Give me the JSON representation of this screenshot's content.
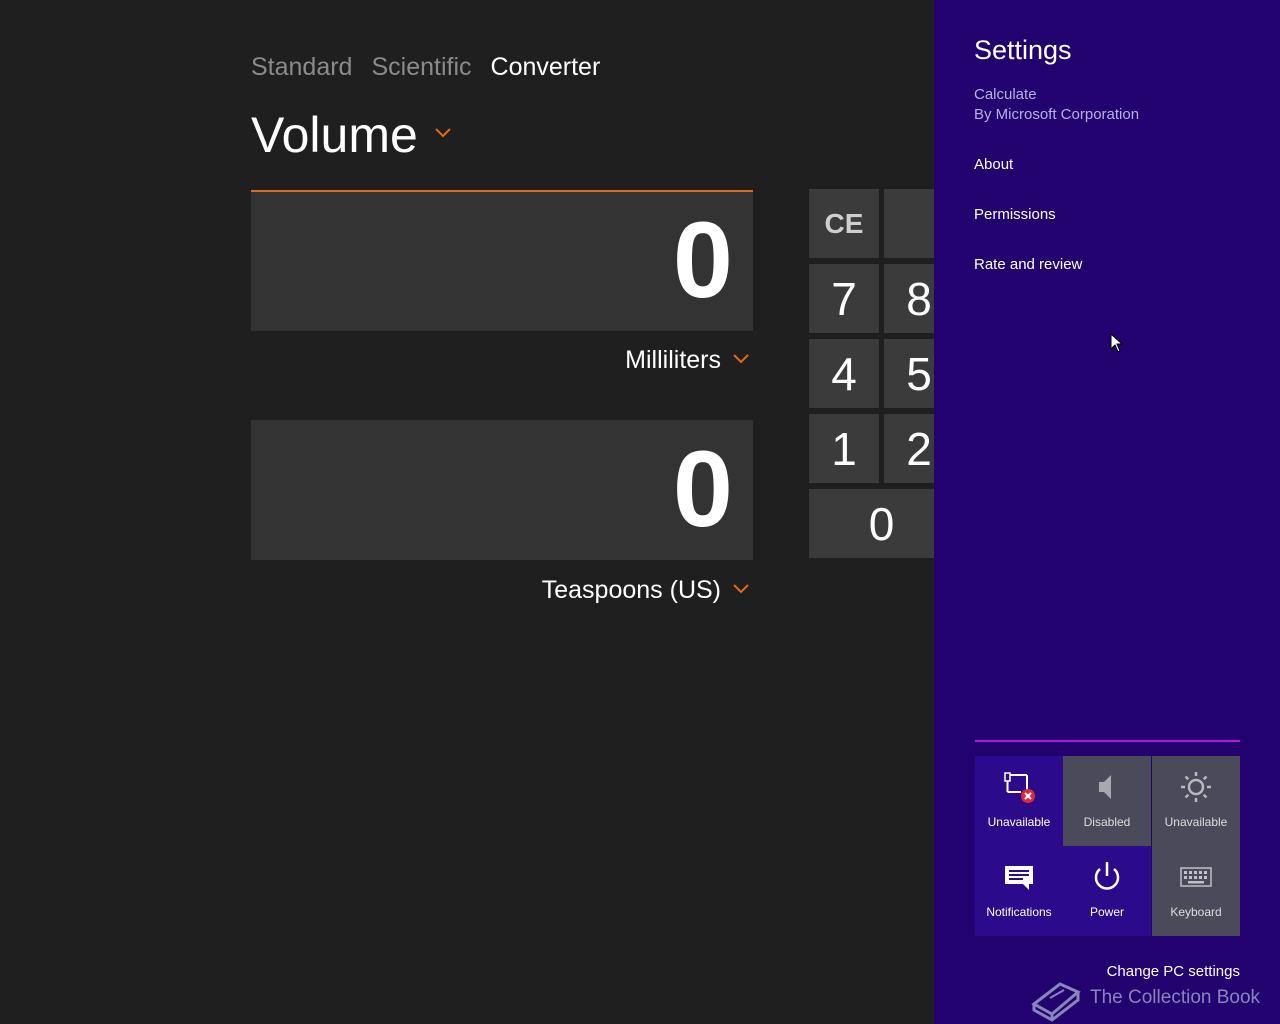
{
  "app": {
    "modes": [
      "Standard",
      "Scientific",
      "Converter"
    ],
    "category": "Volume",
    "from": {
      "value": "0",
      "unit": "Milliliters"
    },
    "to": {
      "value": "0",
      "unit": "Teaspoons (US)"
    },
    "keypad": [
      "CE",
      "7",
      "8",
      "4",
      "5",
      "1",
      "2",
      "0"
    ],
    "accent": "#e06a18"
  },
  "charm": {
    "title": "Settings",
    "app_name": "Calculate",
    "publisher": "By Microsoft Corporation",
    "links": [
      "About",
      "Permissions",
      "Rate and review"
    ],
    "tiles": [
      {
        "icon": "network-unavailable-icon",
        "label": "Unavailable"
      },
      {
        "icon": "volume-icon",
        "label": "Disabled"
      },
      {
        "icon": "brightness-icon",
        "label": "Unavailable"
      },
      {
        "icon": "notifications-icon",
        "label": "Notifications"
      },
      {
        "icon": "power-icon",
        "label": "Power"
      },
      {
        "icon": "keyboard-icon",
        "label": "Keyboard"
      }
    ],
    "change_pc_settings": "Change PC settings",
    "background": "#22026f"
  },
  "watermark": "The Collection Book"
}
